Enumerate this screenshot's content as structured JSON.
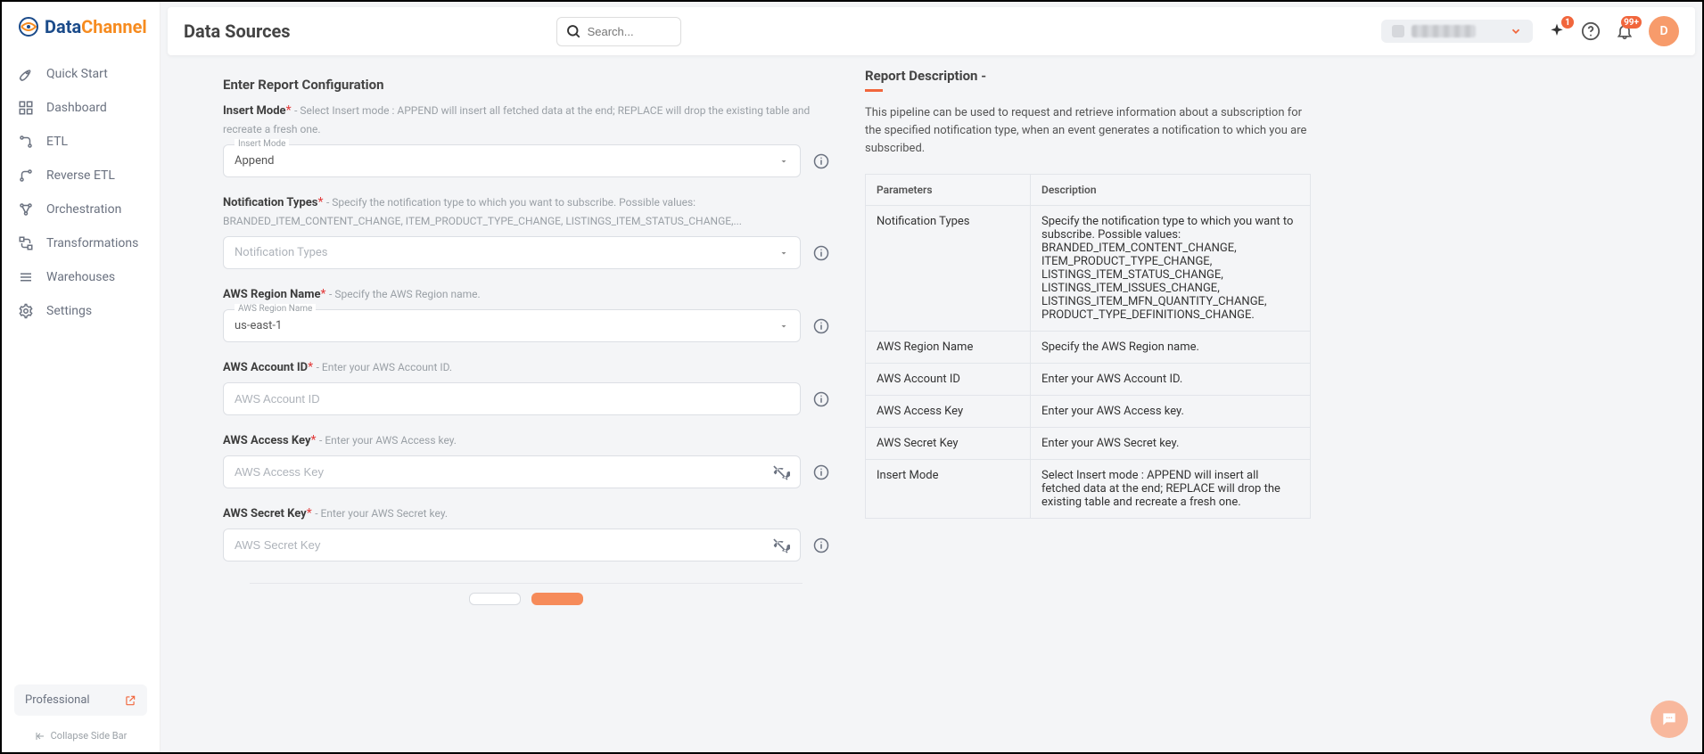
{
  "brand": {
    "text1": "Data",
    "text2": "Channel"
  },
  "sidebar": {
    "items": [
      {
        "label": "Quick Start"
      },
      {
        "label": "Dashboard"
      },
      {
        "label": "ETL"
      },
      {
        "label": "Reverse ETL"
      },
      {
        "label": "Orchestration"
      },
      {
        "label": "Transformations"
      },
      {
        "label": "Warehouses"
      },
      {
        "label": "Settings"
      }
    ],
    "plan": "Professional",
    "collapse": "Collapse Side Bar"
  },
  "header": {
    "page_title": "Data Sources",
    "search_placeholder": "Search...",
    "badge_sparkle": "1",
    "badge_bell": "99+",
    "avatar_initial": "D"
  },
  "form": {
    "title": "Enter Report Configuration",
    "insert_mode": {
      "label": "Insert Mode",
      "help": "- Select Insert mode : APPEND will insert all fetched data at the end; REPLACE will drop the existing table and recreate a fresh one.",
      "float": "Insert Mode",
      "value": "Append"
    },
    "notification_types": {
      "label": "Notification Types",
      "help": "- Specify the notification type to which you want to subscribe. Possible values: BRANDED_ITEM_CONTENT_CHANGE, ITEM_PRODUCT_TYPE_CHANGE, LISTINGS_ITEM_STATUS_CHANGE,...",
      "placeholder": "Notification Types"
    },
    "aws_region": {
      "label": "AWS Region Name",
      "help": "- Specify the AWS Region name.",
      "float": "AWS Region Name",
      "value": "us-east-1"
    },
    "aws_account_id": {
      "label": "AWS Account ID",
      "help": "- Enter your AWS Account ID.",
      "placeholder": "AWS Account ID"
    },
    "aws_access_key": {
      "label": "AWS Access Key",
      "help": "- Enter your AWS Access key.",
      "placeholder": "AWS Access Key"
    },
    "aws_secret_key": {
      "label": "AWS Secret Key",
      "help": "- Enter your AWS Secret key.",
      "placeholder": "AWS Secret Key"
    }
  },
  "description": {
    "title": "Report Description -",
    "text": "This pipeline can be used to request and retrieve information about a subscription for the specified notification type, when an event generates a notification to which you are subscribed.",
    "headers": {
      "param": "Parameters",
      "desc": "Description"
    },
    "rows": [
      {
        "param": "Notification Types",
        "desc": "Specify the notification type to which you want to subscribe. Possible values: BRANDED_ITEM_CONTENT_CHANGE, ITEM_PRODUCT_TYPE_CHANGE, LISTINGS_ITEM_STATUS_CHANGE, LISTINGS_ITEM_ISSUES_CHANGE, LISTINGS_ITEM_MFN_QUANTITY_CHANGE, PRODUCT_TYPE_DEFINITIONS_CHANGE."
      },
      {
        "param": "AWS Region Name",
        "desc": "Specify the AWS Region name."
      },
      {
        "param": "AWS Account ID",
        "desc": "Enter your AWS Account ID."
      },
      {
        "param": "AWS Access Key",
        "desc": "Enter your AWS Access key."
      },
      {
        "param": "AWS Secret Key",
        "desc": "Enter your AWS Secret key."
      },
      {
        "param": "Insert Mode",
        "desc": "Select Insert mode : APPEND will insert all fetched data at the end; REPLACE will drop the existing table and recreate a fresh one."
      }
    ]
  }
}
